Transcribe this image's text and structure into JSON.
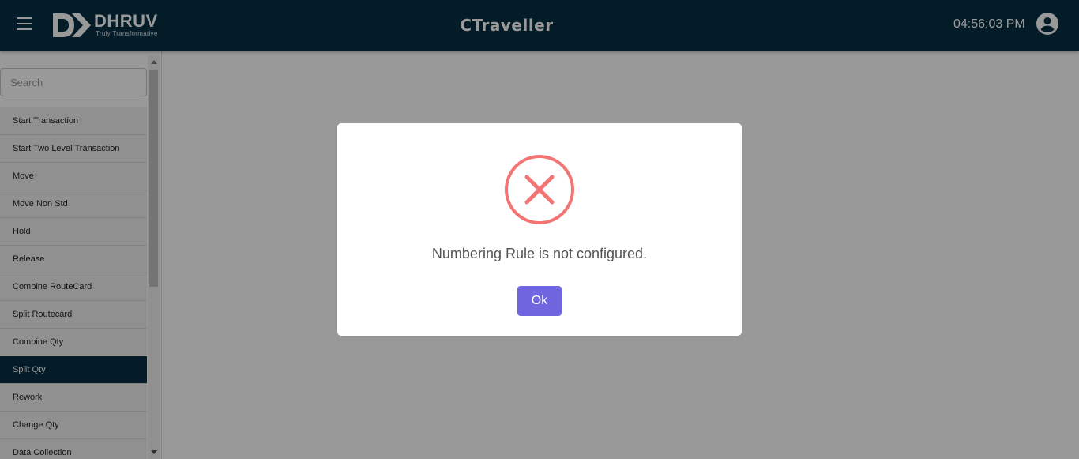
{
  "header": {
    "logo_text": "DHRUV",
    "logo_tagline": "Truly Transformative",
    "app_title": "CTraveller",
    "clock": "04:56:03 PM",
    "menu_icon": "hamburger-menu-icon",
    "user_icon": "account-circle-icon",
    "bg_color": "#062f42"
  },
  "sidebar": {
    "search": {
      "placeholder": "Search",
      "value": ""
    },
    "items": [
      {
        "label": "Start Transaction",
        "active": false
      },
      {
        "label": "Start Two Level Transaction",
        "active": false
      },
      {
        "label": "Move",
        "active": false
      },
      {
        "label": "Move Non Std",
        "active": false
      },
      {
        "label": "Hold",
        "active": false
      },
      {
        "label": "Release",
        "active": false
      },
      {
        "label": "Combine RouteCard",
        "active": false
      },
      {
        "label": "Split Routecard",
        "active": false
      },
      {
        "label": "Combine Qty",
        "active": false
      },
      {
        "label": "Split Qty",
        "active": true
      },
      {
        "label": "Rework",
        "active": false
      },
      {
        "label": "Change Qty",
        "active": false
      },
      {
        "label": "Data Collection",
        "active": false
      }
    ]
  },
  "modal": {
    "icon": "error-x-icon",
    "message": "Numbering Rule is not configured.",
    "ok_label": "Ok",
    "error_color": "#f27474",
    "button_color": "#7066e0"
  }
}
